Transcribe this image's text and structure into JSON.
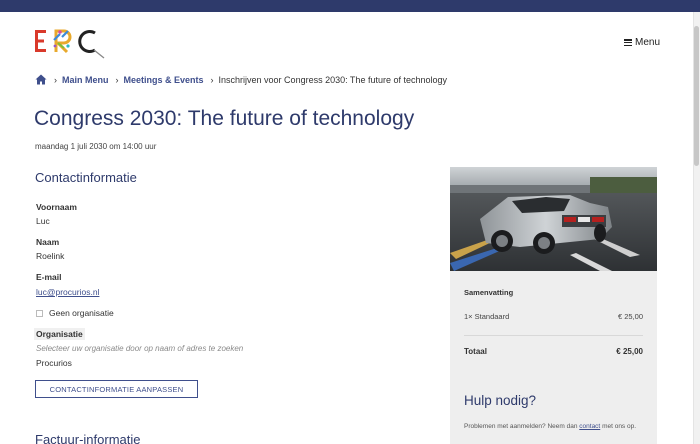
{
  "header": {
    "logo_text": "ERC",
    "menu_label": "Menu"
  },
  "breadcrumb": {
    "items": [
      "Main Menu",
      "Meetings & Events"
    ],
    "current": "Inschrijven voor Congress 2030: The future of technology"
  },
  "event": {
    "title": "Congress 2030: The future of technology",
    "date": "maandag 1 juli 2030 om 14:00 uur"
  },
  "contact": {
    "section_title": "Contactinformatie",
    "first_name_label": "Voornaam",
    "first_name": "Luc",
    "last_name_label": "Naam",
    "last_name": "Roelink",
    "email_label": "E-mail",
    "email": "luc@procurios.nl",
    "no_org_label": "Geen organisatie",
    "org_label": "Organisatie",
    "org_hint": "Selecteer uw organisatie door op naam of adres te zoeken",
    "org_value": "Procurios",
    "edit_button": "CONTACTINFORMATIE AANPASSEN"
  },
  "invoice": {
    "section_title": "Factuur-informatie"
  },
  "summary": {
    "title": "Samenvatting",
    "line_label": "1× Standaard",
    "line_price": "€ 25,00",
    "total_label": "Totaal",
    "total_price": "€ 25,00"
  },
  "help": {
    "title": "Hulp nodig?",
    "text_before": "Problemen met aanmelden? Neem dan",
    "link": "contact",
    "text_after": "met ons op."
  },
  "colors": {
    "brand": "#2e3a6b",
    "link": "#3f4f8c"
  }
}
